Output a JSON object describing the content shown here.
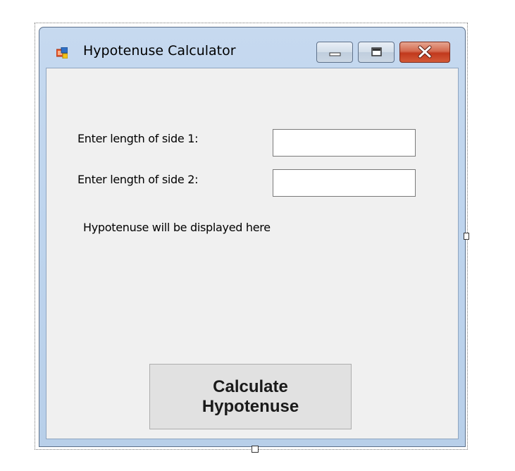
{
  "window": {
    "title": "Hypotenuse Calculator",
    "icon": "windows-form-icon",
    "controls": {
      "minimize": "minimize-icon",
      "maximize": "maximize-icon",
      "close": "close-icon"
    }
  },
  "form": {
    "side1_label": "Enter length of side 1:",
    "side1_value": "",
    "side2_label": "Enter length of side 2:",
    "side2_value": "",
    "result_text": "Hypotenuse will be displayed here",
    "calculate_button": {
      "line1": "Calculate",
      "line2": "Hypotenuse"
    }
  },
  "colors": {
    "form_background": "#f0f0f0",
    "close_button": "#c1391d",
    "window_frame": "#bfd5ee"
  }
}
